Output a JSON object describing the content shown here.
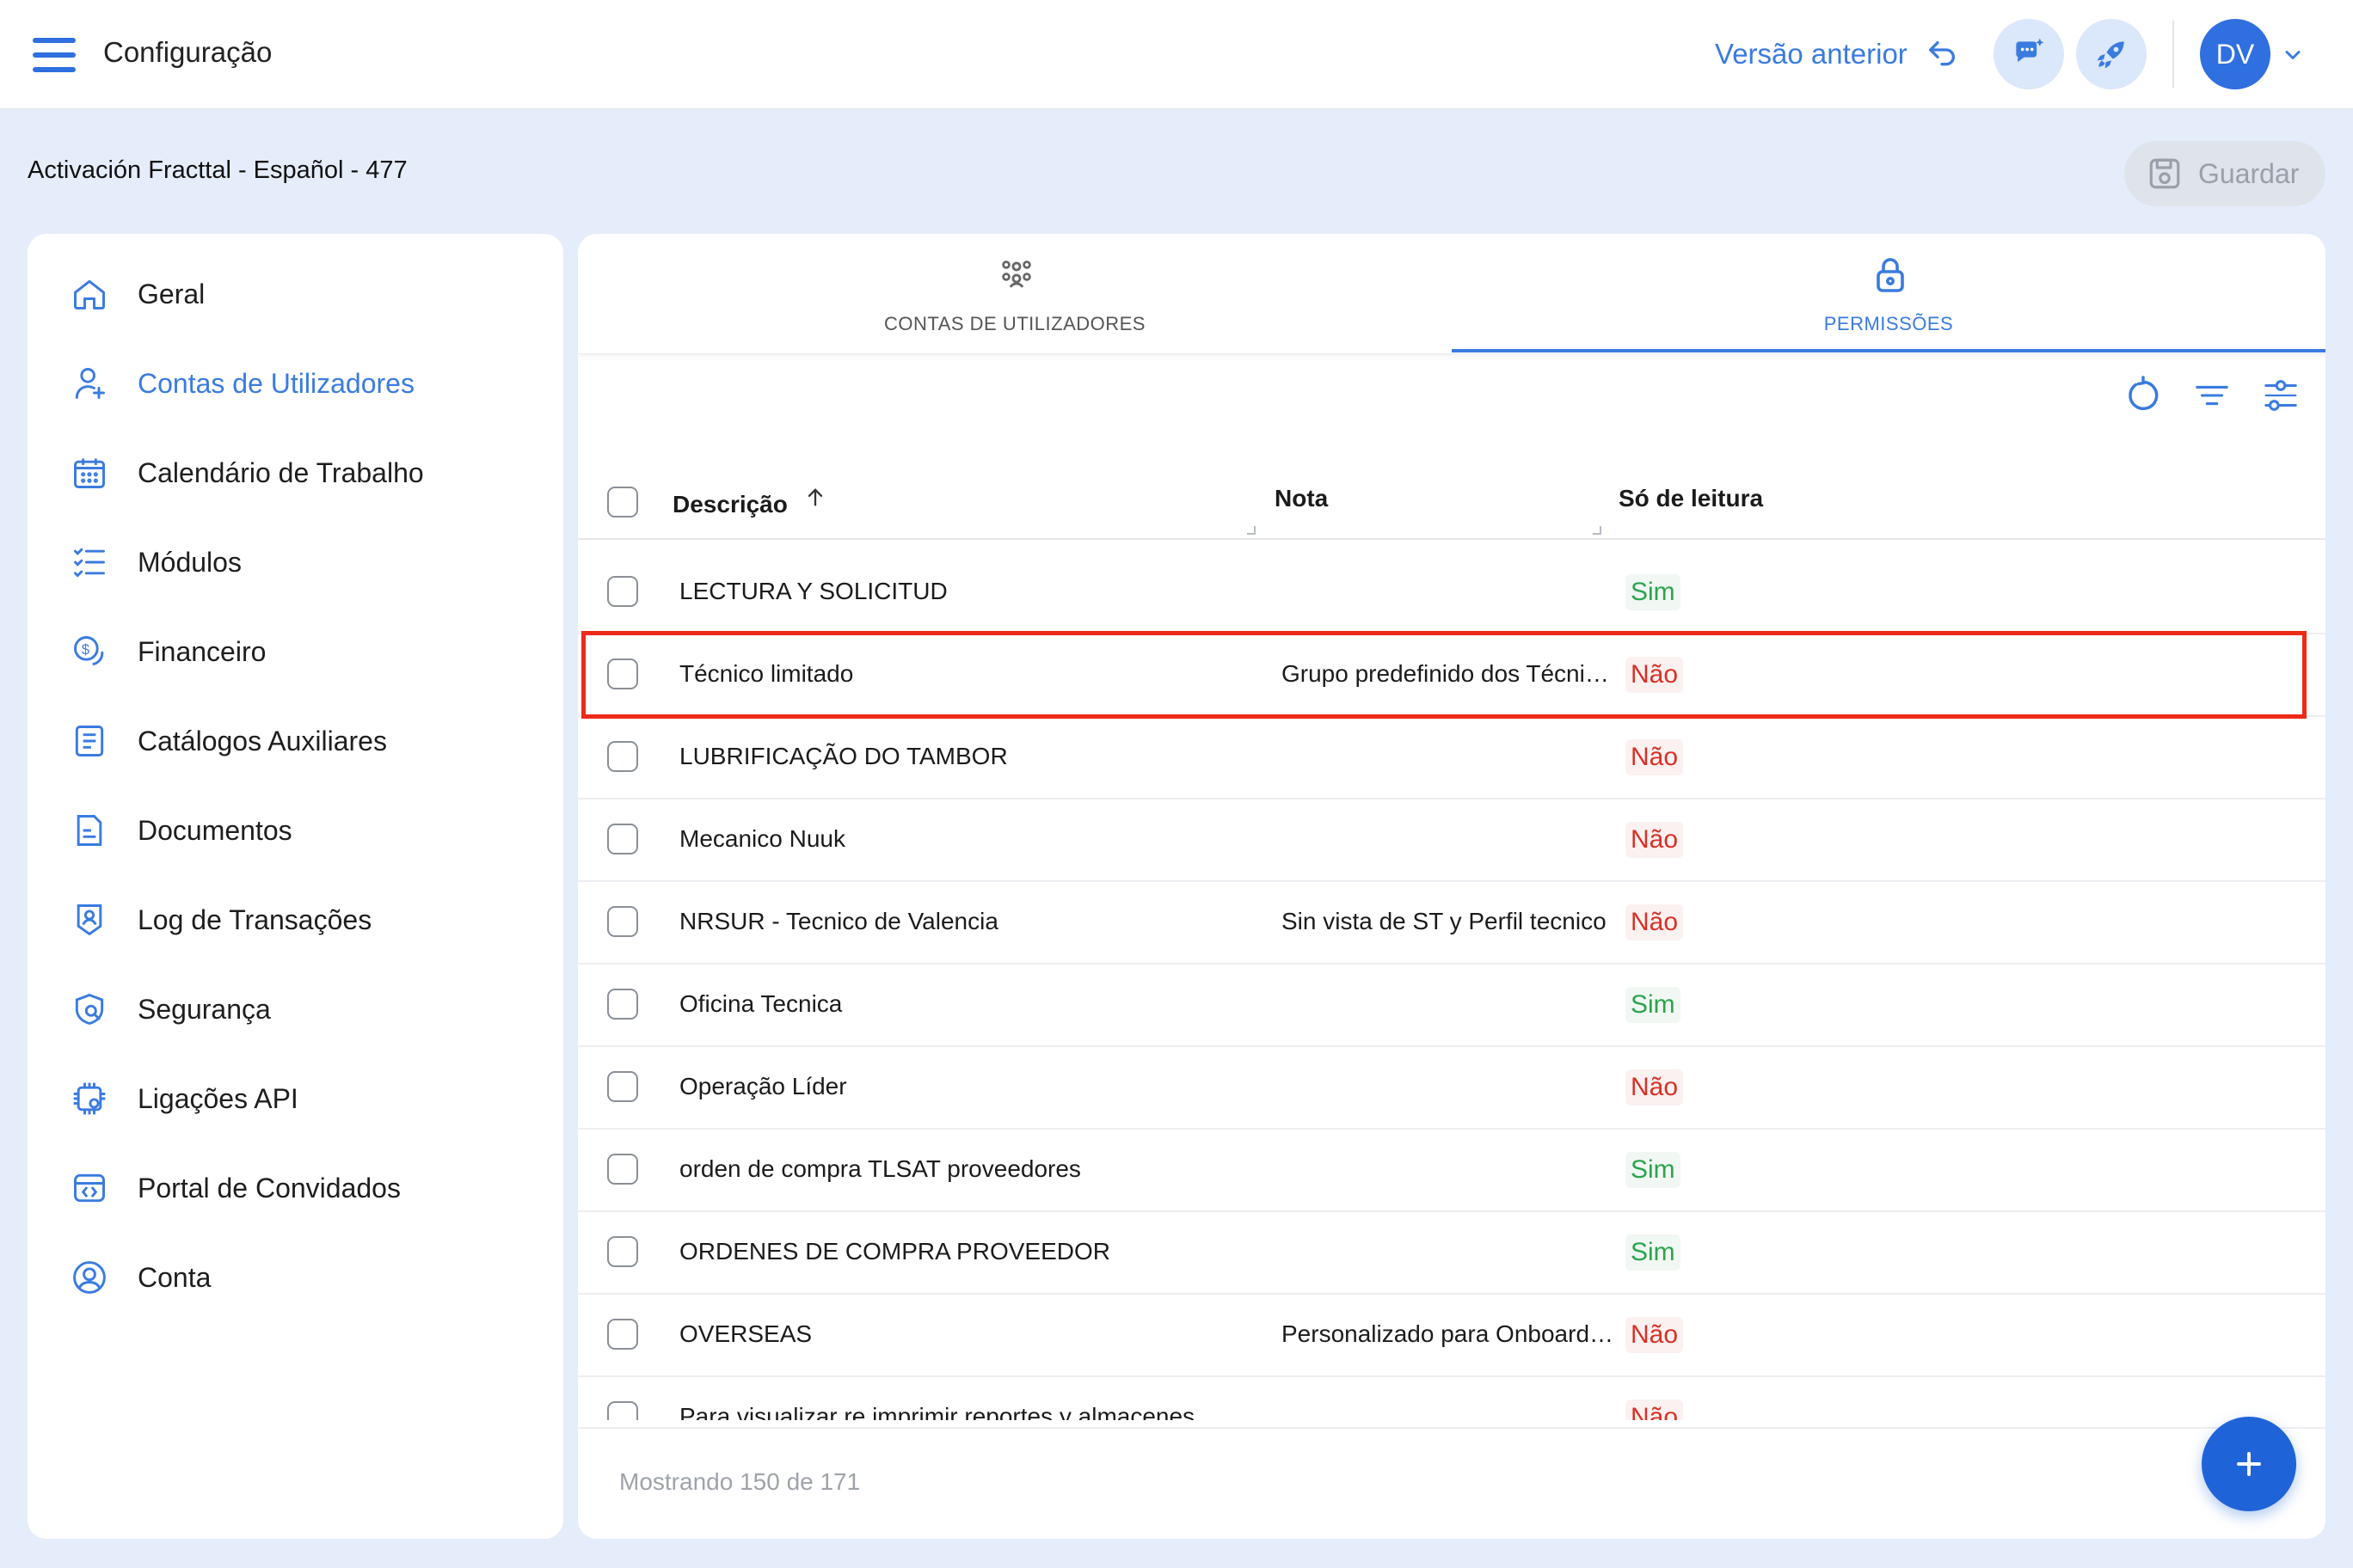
{
  "header": {
    "app_title": "Configuração",
    "prev_version_label": "Versão anterior",
    "avatar_initials": "DV"
  },
  "context": {
    "title": "Activación Fracttal - Español - 477",
    "save_label": "Guardar"
  },
  "sidebar": {
    "items": [
      {
        "label": "Geral",
        "icon": "home-icon"
      },
      {
        "label": "Contas de Utilizadores",
        "icon": "user-plus-icon",
        "active": true
      },
      {
        "label": "Calendário de Trabalho",
        "icon": "calendar-icon"
      },
      {
        "label": "Módulos",
        "icon": "checklist-icon"
      },
      {
        "label": "Financeiro",
        "icon": "coin-icon"
      },
      {
        "label": "Catálogos Auxiliares",
        "icon": "catalog-icon"
      },
      {
        "label": "Documentos",
        "icon": "document-icon"
      },
      {
        "label": "Log de Transações",
        "icon": "user-shield-icon"
      },
      {
        "label": "Segurança",
        "icon": "shield-search-icon"
      },
      {
        "label": "Ligações API",
        "icon": "api-gear-icon"
      },
      {
        "label": "Portal de Convidados",
        "icon": "portal-code-icon"
      },
      {
        "label": "Conta",
        "icon": "account-circle-icon"
      }
    ]
  },
  "tabs": [
    {
      "label": "CONTAS DE UTILIZADORES",
      "icon": "group-icon"
    },
    {
      "label": "PERMISSÕES",
      "icon": "lock-icon",
      "active": true
    }
  ],
  "table": {
    "columns": {
      "description": "Descrição",
      "note": "Nota",
      "read_only": "Só de leitura"
    },
    "rows": [
      {
        "description": "LECTURA Y SOLICITUD",
        "note": "",
        "read_only": "Sim"
      },
      {
        "description": "Técnico limitado",
        "note": "Grupo predefinido dos Técnicos",
        "read_only": "Não",
        "highlighted": true
      },
      {
        "description": "LUBRIFICAÇÃO DO TAMBOR",
        "note": "",
        "read_only": "Não"
      },
      {
        "description": "Mecanico Nuuk",
        "note": "",
        "read_only": "Não"
      },
      {
        "description": "NRSUR - Tecnico de Valencia",
        "note": "Sin vista de ST y Perfil tecnico",
        "read_only": "Não"
      },
      {
        "description": "Oficina Tecnica",
        "note": "",
        "read_only": "Sim"
      },
      {
        "description": "Operação Líder",
        "note": "",
        "read_only": "Não"
      },
      {
        "description": "orden de compra TLSAT proveedores",
        "note": "",
        "read_only": "Sim"
      },
      {
        "description": "ORDENES DE COMPRA PROVEEDOR",
        "note": "",
        "read_only": "Sim"
      },
      {
        "description": "OVERSEAS",
        "note": "Personalizado para Onboarding",
        "read_only": "Não"
      },
      {
        "description": "Para visualizar re imprimir reportes y almacenes",
        "note": "",
        "read_only": "Não"
      }
    ],
    "footer": "Mostrando 150 de 171"
  },
  "colors": {
    "accent": "#3a7be0",
    "fab": "#1f63d8",
    "yes": "#2da44e",
    "no": "#d93025",
    "highlight": "#ee2a18"
  }
}
